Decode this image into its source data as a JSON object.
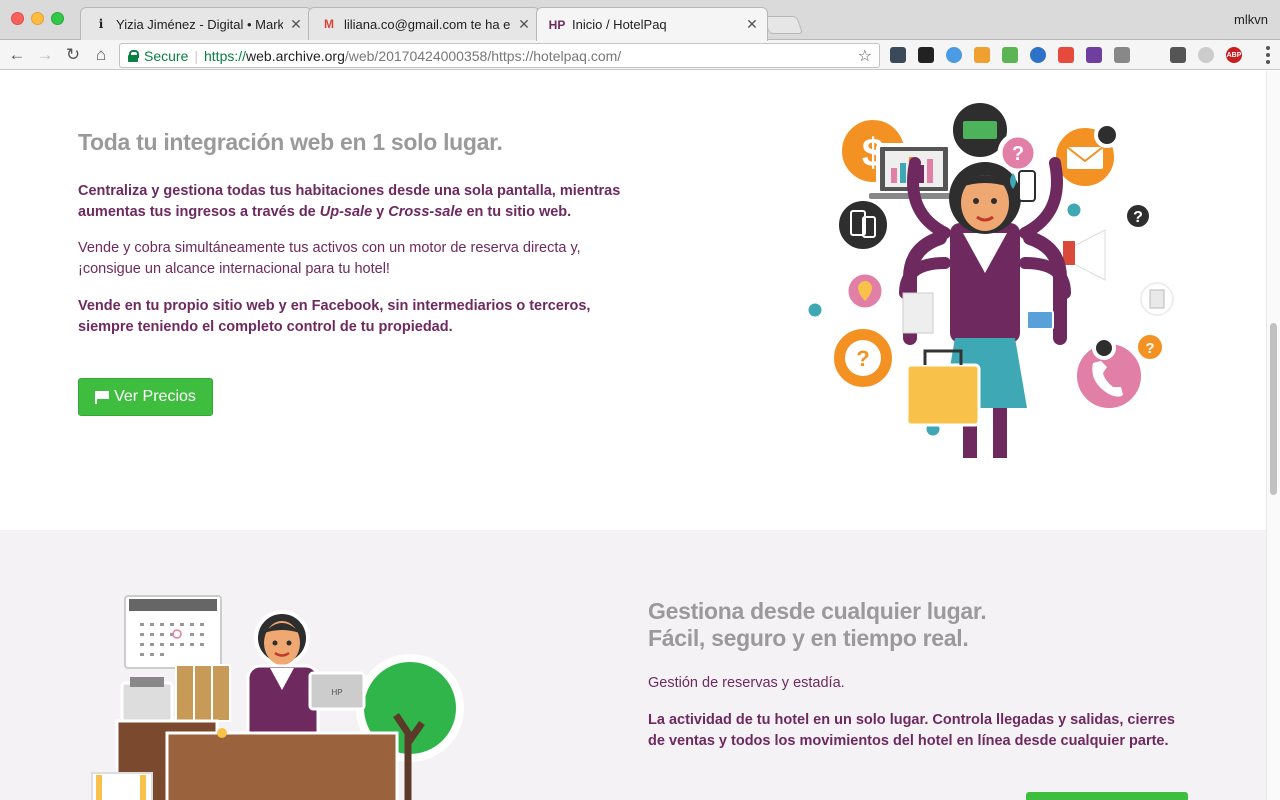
{
  "browser": {
    "tabs": [
      {
        "title": "Yizia Jiménez - Digital • Marke",
        "favicon": "info-icon"
      },
      {
        "title": "liliana.co@gmail.com te ha env",
        "favicon": "gmail-icon"
      },
      {
        "title": "Inicio / HotelPaq",
        "favicon": "hotelpaq-icon"
      }
    ],
    "profile": "mlkvn",
    "secure_label": "Secure",
    "url": {
      "scheme": "https://",
      "host": "web.archive.org",
      "rest": "/web/20170424000358/https://hotelpaq.com/"
    }
  },
  "section1": {
    "title": "Toda tu integración web en 1 solo lugar.",
    "p1_a": "Centraliza y gestiona todas tus habitaciones desde una sola pantalla, mientras aumentas tus ingresos a través de ",
    "p1_upsale": "Up-sale",
    "p1_y": " y ",
    "p1_crosssale": "Cross-sale",
    "p1_b": " en tu sitio web.",
    "p2": "Vende y cobra simultáneamente tus activos con un motor de reserva directa y, ¡consigue un alcance internacional para tu hotel!",
    "p3": "Vende en tu propio sitio web y en Facebook, sin intermediarios o terceros, siempre teniendo el completo control de tu propiedad.",
    "cta": "Ver Precios"
  },
  "section2": {
    "title_line1": "Gestiona desde cualquier lugar.",
    "title_line2": "Fácil, seguro y en tiempo real.",
    "p1": "Gestión de reservas y estadía.",
    "p2": "La actividad de tu hotel en un solo lugar. Controla llegadas y salidas, cierres de ventas y todos los movimientos del hotel en línea desde cualquier parte."
  },
  "colors": {
    "accent_green": "#3fbd3f",
    "text_purple": "#6e2a5f",
    "heading_gray": "#9a9a9a",
    "orange": "#f39223",
    "pink": "#e27fa6",
    "teal": "#3ea8b5"
  }
}
